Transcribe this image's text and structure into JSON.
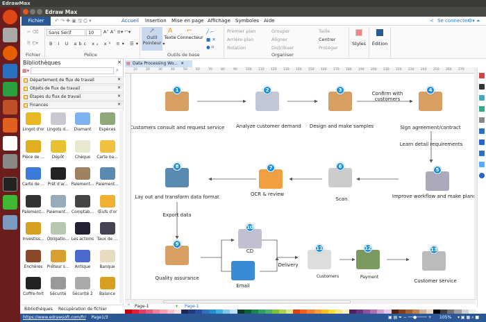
{
  "os": {
    "top_title": "EdrawMax"
  },
  "window": {
    "title": "Edraw Max"
  },
  "menu": {
    "file": "Fichier",
    "tabs": [
      "Accueil",
      "Insertion",
      "Mise en page",
      "Affichage",
      "Symboles",
      "Aide"
    ],
    "connect": "Se connecter"
  },
  "ribbon": {
    "groups": [
      "Fichier",
      "Police",
      "Outils de base",
      "Organiser"
    ],
    "font": "Sans Serif",
    "size": "10",
    "tools": [
      "Outil Pointeur",
      "Texte",
      "Connecteur"
    ],
    "arrange": [
      "Premier plan",
      "Arrière-plan",
      "Rotation",
      "Grouper",
      "Aligner",
      "Distribuer",
      "Taille",
      "Centrer",
      "Protéger"
    ],
    "styles": "Styles",
    "edition": "Édition"
  },
  "library": {
    "title": "Bibliothèques",
    "search_placeholder": "",
    "sections": [
      "Département de flux de travail",
      "Objets de flux de travail",
      "Étapes du flux de travail",
      "Finances"
    ],
    "items": [
      "Lingot d'or",
      "Lingots d...",
      "Diamant",
      "Espèces",
      "Pièce de ...",
      "Dépôt",
      "Chèque",
      "Carte ba...",
      "Carte de ...",
      "Prêt d'ar...",
      "Paiement...",
      "Paiement...",
      "Paiement...",
      "Paiement...",
      "Comptab...",
      "Œufs d'or",
      "Investiss...",
      "Obligatio...",
      "Les actions",
      "Taux de ...",
      "Enchères",
      "Prêteur s...",
      "Antique",
      "Banque",
      "Coffre-fort",
      "Sécurité",
      "Sécurité 2",
      "Balance"
    ],
    "item_colors": [
      "#e8b923",
      "#c8c8d0",
      "#7fb2f0",
      "#8fa87a",
      "#e0b020",
      "#e8c030",
      "#e8e8d0",
      "#f0c040",
      "#3a7ad8",
      "#222",
      "#a08060",
      "#5a8ab0",
      "#333",
      "#9ab",
      "#444",
      "#f0b030",
      "#d8a020",
      "#b8c8b0",
      "#223",
      "#445",
      "#8a4a2a",
      "#d8a030",
      "#4a6ad0",
      "#e8dcc0",
      "#222",
      "#999",
      "#aaa",
      "#d8a020"
    ],
    "bottom_tabs": [
      "Bibliothèques",
      "Récupération de fichier"
    ]
  },
  "document": {
    "tab": "Data Processing Wo...",
    "ruler": [
      "10",
      "20",
      "30",
      "40",
      "50",
      "60",
      "70",
      "80",
      "90",
      "100",
      "110",
      "120",
      "130",
      "140",
      "150",
      "160",
      "170",
      "180",
      "190",
      "200",
      "210",
      "220",
      "230",
      "240",
      "250",
      "260",
      "270"
    ],
    "page_selector": "Page-1",
    "active_page": "Page-1"
  },
  "diagram": {
    "steps": [
      {
        "n": "1",
        "label": "Customers consult and request service"
      },
      {
        "n": "2",
        "label": "Analyze customer demand"
      },
      {
        "n": "3",
        "label": "Design and make samples"
      },
      {
        "n": "4",
        "label": "Sign agreement/contract"
      },
      {
        "n": "5",
        "label": "Improve workflow and make plans"
      },
      {
        "n": "6",
        "label": "Scan"
      },
      {
        "n": "7",
        "label": "OCR & review"
      },
      {
        "n": "8",
        "label": "Lay out and transform data  format"
      },
      {
        "n": "9",
        "label": "Quality assurance"
      },
      {
        "n": "10",
        "label": "CD"
      },
      {
        "n": "11",
        "label": "Customers"
      },
      {
        "n": "12",
        "label": "Payment"
      },
      {
        "n": "13",
        "label": "Customer service"
      }
    ],
    "email": "Email",
    "edge_labels": {
      "confirm": "Confirm with customers",
      "learn": "Learn detail requirements",
      "export": "Export data",
      "delivery": "Delivery"
    }
  },
  "status": {
    "url": "https://www.edrawsoft.com/fr/",
    "page": "Page1/3",
    "zoom": "105%"
  },
  "palette": [
    "#c00000",
    "#e02030",
    "#e04060",
    "#e06080",
    "#f080a0",
    "#f4a0b0",
    "#f8c0c8",
    "#fce0e8",
    "#1a2a5a",
    "#203a80",
    "#2a50a0",
    "#3070c0",
    "#2090d0",
    "#40b0e0",
    "#80c8f0",
    "#c0e0f8",
    "#0a3a2a",
    "#106040",
    "#208050",
    "#30a060",
    "#50b070",
    "#80c040",
    "#b0d050",
    "#d8e890",
    "#e04010",
    "#f06020",
    "#f08030",
    "#f8a030",
    "#f8c020",
    "#f8e040",
    "#f8e890",
    "#fcf0c8",
    "#502060",
    "#703080",
    "#9050a0",
    "#b070b0",
    "#d0a0d0",
    "#e8c8e8",
    "#502010",
    "#804020",
    "#a06030",
    "#c08050",
    "#d0b090",
    "#e8d8c0",
    "#000000",
    "#404040",
    "#707070",
    "#a0a0a0",
    "#d0d0d0",
    "#f0f0f0"
  ],
  "colors": {
    "accent": "#2b5797",
    "step_badge": "#1e8fd8"
  }
}
